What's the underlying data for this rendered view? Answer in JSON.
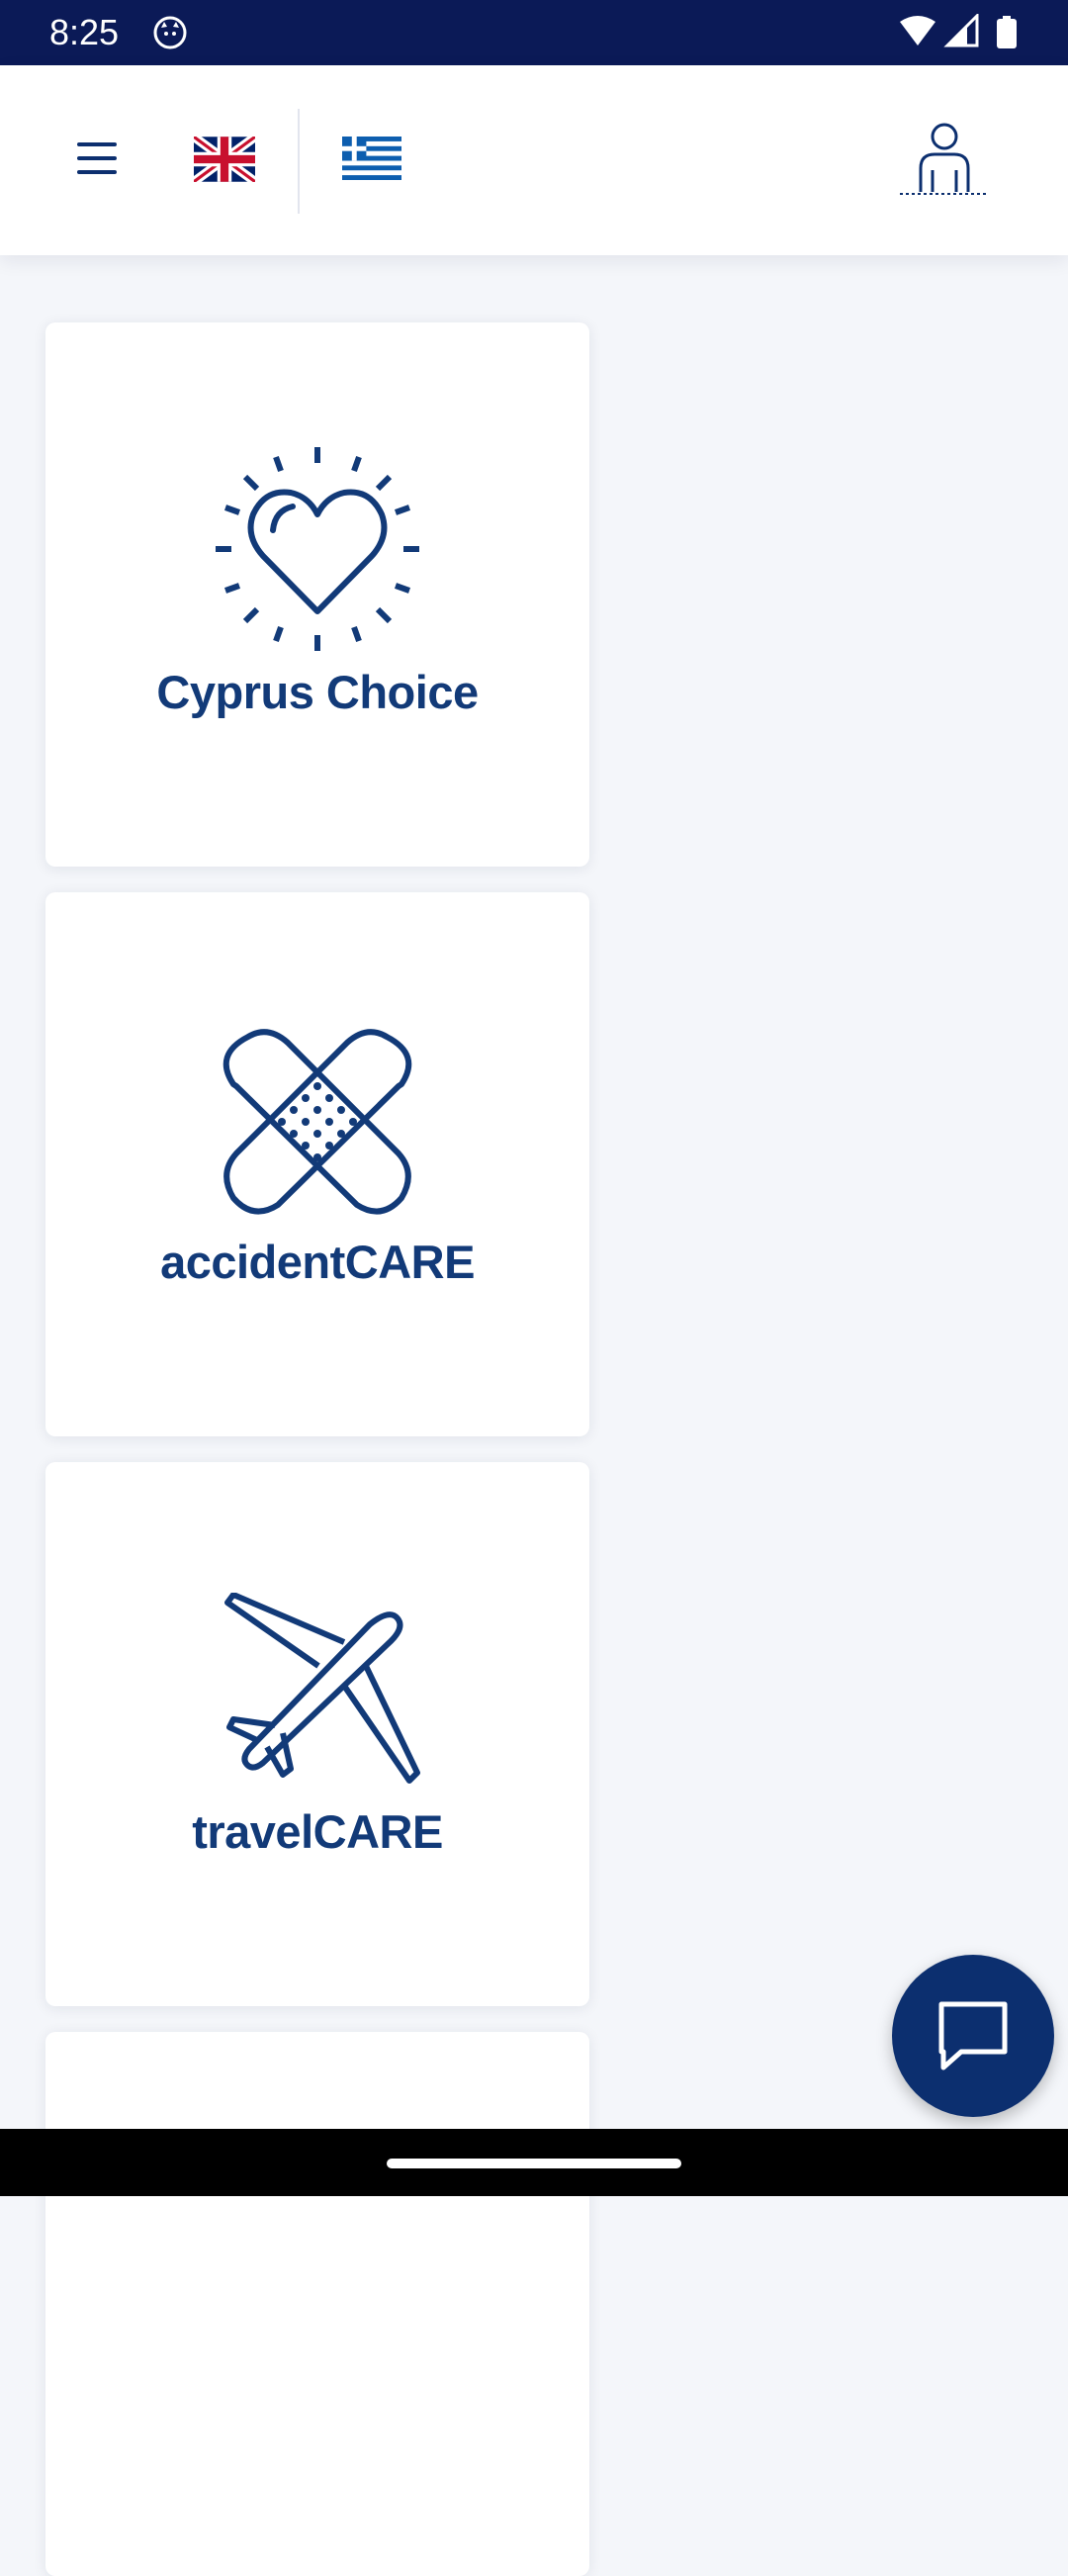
{
  "status_bar": {
    "time": "8:25",
    "icons": [
      "cat-notification-icon",
      "wifi-icon",
      "signal-icon",
      "battery-icon"
    ]
  },
  "header": {
    "icons": [
      "menu-icon",
      "uk-flag-icon",
      "greek-flag-icon",
      "profile-icon"
    ]
  },
  "products": [
    {
      "title": "Cyprus Choice",
      "icon": "heart-icon"
    },
    {
      "title": "accidentCARE",
      "icon": "bandage-icon"
    },
    {
      "title": "travelCARE",
      "icon": "airplane-icon"
    },
    {
      "title": "",
      "icon": ""
    }
  ],
  "chat": {
    "icon": "chat-icon"
  },
  "colors": {
    "status_bar": "#0b1a57",
    "brand_navy": "#123a78",
    "fab": "#0c2f6f",
    "background": "#f4f6fa"
  }
}
